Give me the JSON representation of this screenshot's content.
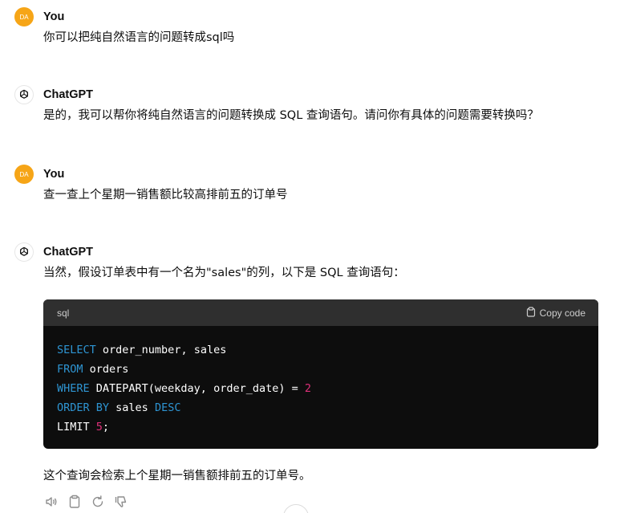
{
  "messages": [
    {
      "author": "You",
      "avatar_text": "DA",
      "text": "你可以把纯自然语言的问题转成sql吗"
    },
    {
      "author": "ChatGPT",
      "text": "是的，我可以帮你将纯自然语言的问题转换成 SQL 查询语句。请问你有具体的问题需要转换吗？"
    },
    {
      "author": "You",
      "avatar_text": "DA",
      "text": "查一查上个星期一销售额比较高排前五的订单号"
    },
    {
      "author": "ChatGPT",
      "text": "当然，假设订单表中有一个名为\"sales\"的列，以下是 SQL 查询语句：",
      "after_code": "这个查询会检索上个星期一销售额排前五的订单号。"
    }
  ],
  "code": {
    "language": "sql",
    "copy_label": "Copy code",
    "lines": [
      [
        {
          "t": "SELECT",
          "c": "kw"
        },
        {
          "t": " order_number, sales"
        }
      ],
      [
        {
          "t": "FROM",
          "c": "kw"
        },
        {
          "t": " orders"
        }
      ],
      [
        {
          "t": "WHERE",
          "c": "kw"
        },
        {
          "t": " DATEPART(weekday, order_date) = "
        },
        {
          "t": "2",
          "c": "num"
        }
      ],
      [
        {
          "t": "ORDER BY",
          "c": "kw"
        },
        {
          "t": " sales "
        },
        {
          "t": "DESC",
          "c": "kw"
        }
      ],
      [
        {
          "t": "LIMIT "
        },
        {
          "t": "5",
          "c": "num"
        },
        {
          "t": ";"
        }
      ]
    ]
  },
  "colors": {
    "user_avatar": "#f6a517",
    "keyword": "#2e95d3",
    "number": "#df3079",
    "code_bg": "#0d0d0d",
    "code_header_bg": "#2f2f2f"
  },
  "action_icons": [
    "speaker-icon",
    "clipboard-icon",
    "regenerate-icon",
    "thumbs-down-icon"
  ]
}
